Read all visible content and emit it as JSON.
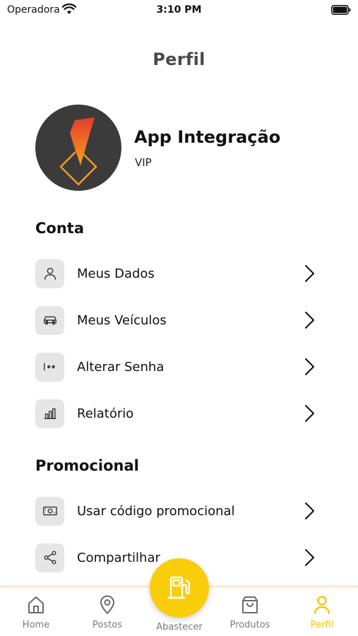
{
  "status_bar": {
    "carrier": "Operadora",
    "time": "3:10 PM"
  },
  "header": {
    "title": "Perfil"
  },
  "profile": {
    "name": "App Integração",
    "tier": "VIP"
  },
  "account_section": {
    "title": "Conta",
    "items": [
      {
        "label": "Meus Dados",
        "icon": "user-icon"
      },
      {
        "label": "Meus Veículos",
        "icon": "car-icon"
      },
      {
        "label": "Alterar Senha",
        "icon": "password-icon"
      },
      {
        "label": "Relatório",
        "icon": "bar-chart-icon"
      }
    ]
  },
  "promo_section": {
    "title": "Promocional",
    "items": [
      {
        "label": "Usar código promocional",
        "icon": "cash-icon"
      },
      {
        "label": "Compartilhar",
        "icon": "share-icon"
      }
    ]
  },
  "bottom_nav": {
    "items": [
      {
        "label": "Home",
        "icon": "home-icon"
      },
      {
        "label": "Postos",
        "icon": "location-pin-icon"
      },
      {
        "label": "Abastecer",
        "icon": "fuel-pump-icon"
      },
      {
        "label": "Produtos",
        "icon": "shopping-bag-icon"
      },
      {
        "label": "Perfil",
        "icon": "user-icon"
      }
    ],
    "active": "Perfil"
  },
  "colors": {
    "accent": "#f9cd0c",
    "active_tab": "#f5c400",
    "icon_bg": "#e6e6e6",
    "avatar_bg": "#3b3b3b"
  }
}
